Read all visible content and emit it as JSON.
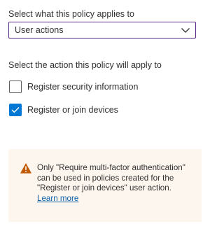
{
  "applies_to": {
    "label": "Select what this policy applies to",
    "selected_value": "User actions",
    "chevron_icon": "chevron-down-icon",
    "border_color": "#5b2a86"
  },
  "actions": {
    "label": "Select the action this policy will apply to",
    "options": [
      {
        "label": "Register security information",
        "checked": false
      },
      {
        "label": "Register or join devices",
        "checked": true
      }
    ],
    "checked_color": "#0078d4"
  },
  "warning": {
    "icon": "warning-icon",
    "icon_color": "#c15a00",
    "background": "#fdf6ef",
    "message": "Only \"Require multi-factor authentication\" can be used in policies created for the \"Register or join devices\" user action.",
    "link_text": "Learn more",
    "link_color": "#0f5fa8"
  }
}
